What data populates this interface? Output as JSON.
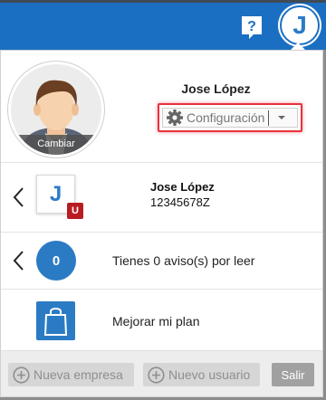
{
  "topbar": {
    "help_icon": "question-chat-icon",
    "user_initial": "J",
    "bg_color": "#1b6fc2"
  },
  "profile": {
    "change_photo_label": "Cambiar",
    "name": "Jose López",
    "settings_label": "Configuración",
    "settings_icon": "gear-icon",
    "highlight_color": "#e8323c"
  },
  "account": {
    "initial": "J",
    "badge": "U",
    "name": "Jose López",
    "id": "12345678Z"
  },
  "notices": {
    "count": "0",
    "text": "Tienes 0 aviso(s) por leer"
  },
  "plan": {
    "icon": "shopping-bag-icon",
    "text": "Mejorar mi plan"
  },
  "footer": {
    "new_company_label": "Nueva empresa",
    "new_user_label": "Nuevo usuario",
    "exit_label": "Salir"
  }
}
